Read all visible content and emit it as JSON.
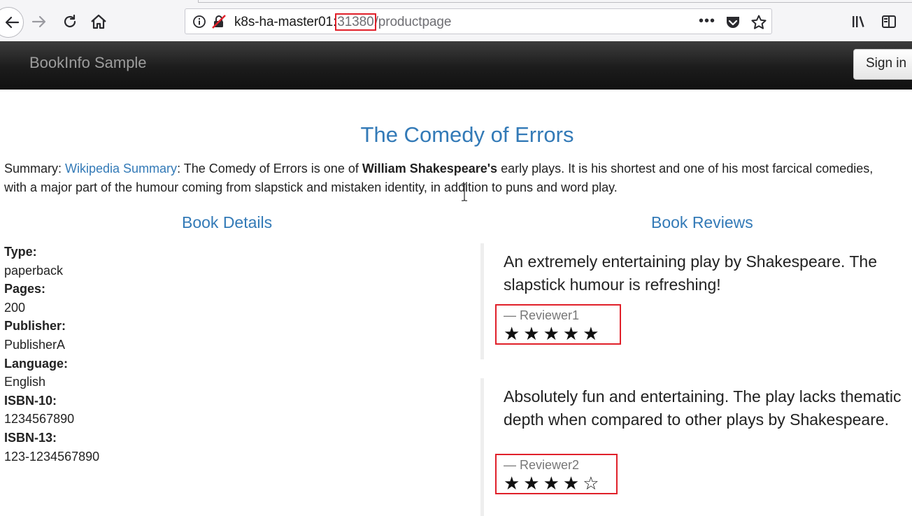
{
  "browser": {
    "url_host": "k8s-ha-master01:",
    "url_port": "31380",
    "url_path": "/productpage",
    "more_label": "•••",
    "icons": [
      "back-arrow-icon",
      "forward-arrow-icon",
      "reload-icon",
      "home-icon",
      "info-icon",
      "insecure-lock-icon",
      "pocket-icon",
      "bookmark-star-icon",
      "library-icon",
      "sidebar-icon"
    ],
    "highlight_color": "#e0202a"
  },
  "navbar": {
    "brand": "BookInfo Sample",
    "signin_label": "Sign in"
  },
  "book": {
    "title": "The Comedy of Errors",
    "summary_label": "Summary: ",
    "summary_link": "Wikipedia Summary",
    "summary_part1": ": The Comedy of Errors is one of ",
    "summary_bold": "William Shakespeare's",
    "summary_part2": " early plays. It is his shortest and one of his most farcical comedies,",
    "summary_line2": "with a major part of the humour coming from slapstick and mistaken identity, in addition to puns and word play."
  },
  "details": {
    "heading": "Book Details",
    "fields": [
      {
        "label": "Type:",
        "value": "paperback"
      },
      {
        "label": "Pages:",
        "value": "200"
      },
      {
        "label": "Publisher:",
        "value": "PublisherA"
      },
      {
        "label": "Language:",
        "value": "English"
      },
      {
        "label": "ISBN-10:",
        "value": "1234567890"
      },
      {
        "label": "ISBN-13:",
        "value": "123-1234567890"
      }
    ]
  },
  "reviews": {
    "heading": "Book Reviews",
    "items": [
      {
        "text": "An extremely entertaining play by Shakespeare. The slapstick humour is refreshing!",
        "reviewer": "— Reviewer1",
        "rating": 5,
        "stars": "★★★★★"
      },
      {
        "text": "Absolutely fun and entertaining. The play lacks thematic depth when compared to other plays by Shakespeare.",
        "reviewer": "— Reviewer2",
        "rating": 4,
        "stars": "★★★★☆"
      }
    ]
  },
  "colors": {
    "link": "#337ab7",
    "navbar_bg": "#222222",
    "brand_text": "#9d9d9d"
  }
}
